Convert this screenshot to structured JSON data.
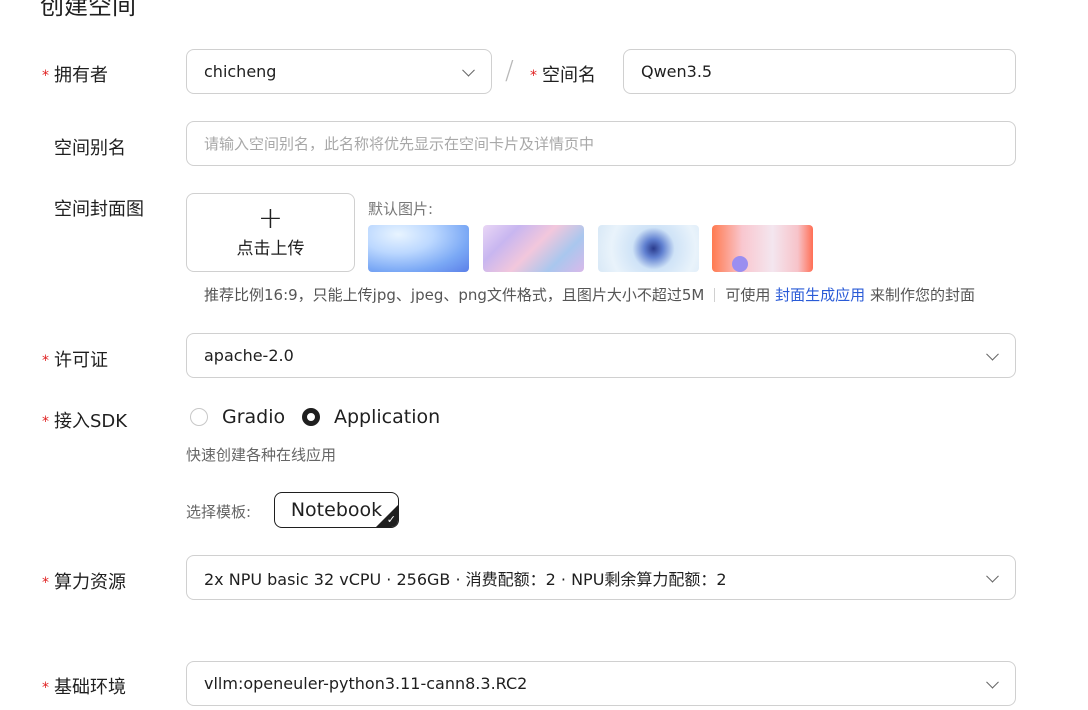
{
  "page": {
    "title": "创建空间"
  },
  "owner": {
    "label": "拥有者",
    "value": "chicheng"
  },
  "space_name": {
    "label": "空间名",
    "value": "Qwen3.5"
  },
  "alias": {
    "label": "空间别名",
    "placeholder": "请输入空间别名，此名称将优先显示在空间卡片及详情页中"
  },
  "cover": {
    "label": "空间封面图",
    "upload_plus": "+",
    "upload_label": "点击上传",
    "default_label": "默认图片:",
    "hint": "推荐比例16:9，只能上传jpg、jpeg、png文件格式，且图片大小不超过5M",
    "hint_prefix": "可使用",
    "hint_link": "封面生成应用",
    "hint_suffix": "来制作您的封面"
  },
  "license": {
    "label": "许可证",
    "value": "apache-2.0"
  },
  "sdk": {
    "label": "接入SDK",
    "options": [
      {
        "label": "Gradio",
        "selected": false
      },
      {
        "label": "Application",
        "selected": true
      }
    ],
    "description": "快速创建各种在线应用",
    "template_label": "选择模板:",
    "template_value": "Notebook"
  },
  "compute": {
    "label": "算力资源",
    "value": "2x NPU basic 32 vCPU · 256GB · 消费配额：2 · NPU剩余算力配额：2"
  },
  "base_env": {
    "label": "基础环境",
    "value": "vllm:openeuler-python3.11-cann8.3.RC2"
  },
  "colors": {
    "required": "#e02020",
    "link": "#2a5bd7",
    "border": "#d0d0d0"
  }
}
